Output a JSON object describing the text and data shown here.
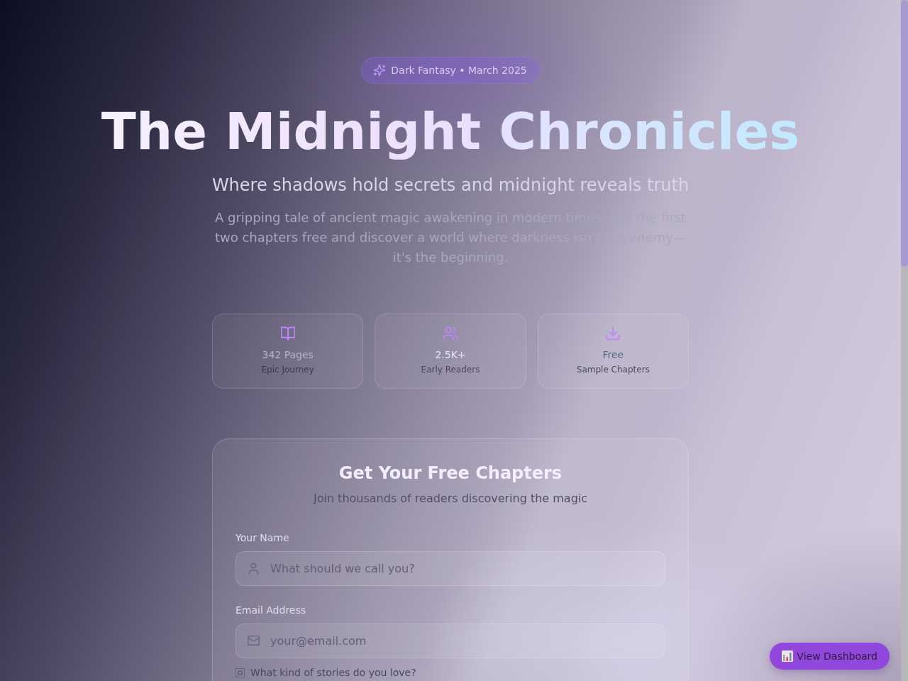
{
  "badge": {
    "label": "Dark Fantasy • March 2025"
  },
  "hero": {
    "title": "The Midnight Chronicles",
    "subtitle": "Where shadows hold secrets and midnight reveals truth",
    "description": "A gripping tale of ancient magic awakening in modern times. Get the first two chapters free and discover a world where darkness isn't the enemy—it's the beginning."
  },
  "stats": [
    {
      "kind": "book",
      "value": "342 Pages",
      "label": "Epic Journey"
    },
    {
      "kind": "readers",
      "value": "2.5K+",
      "label": "Early Readers"
    },
    {
      "kind": "download",
      "value": "Free",
      "label": "Sample Chapters"
    }
  ],
  "signup_form": {
    "title": "Get Your Free Chapters",
    "subtitle": "Join thousands of readers discovering the magic",
    "fields": [
      {
        "kind": "name",
        "label": "Your Name",
        "placeholder": "What should we call you?"
      },
      {
        "kind": "email",
        "label": "Email Address",
        "placeholder": "your@email.com"
      }
    ],
    "next_question": {
      "label": "What kind of stories do you love?"
    }
  },
  "dashboard_button": {
    "label": "View Dashboard"
  }
}
